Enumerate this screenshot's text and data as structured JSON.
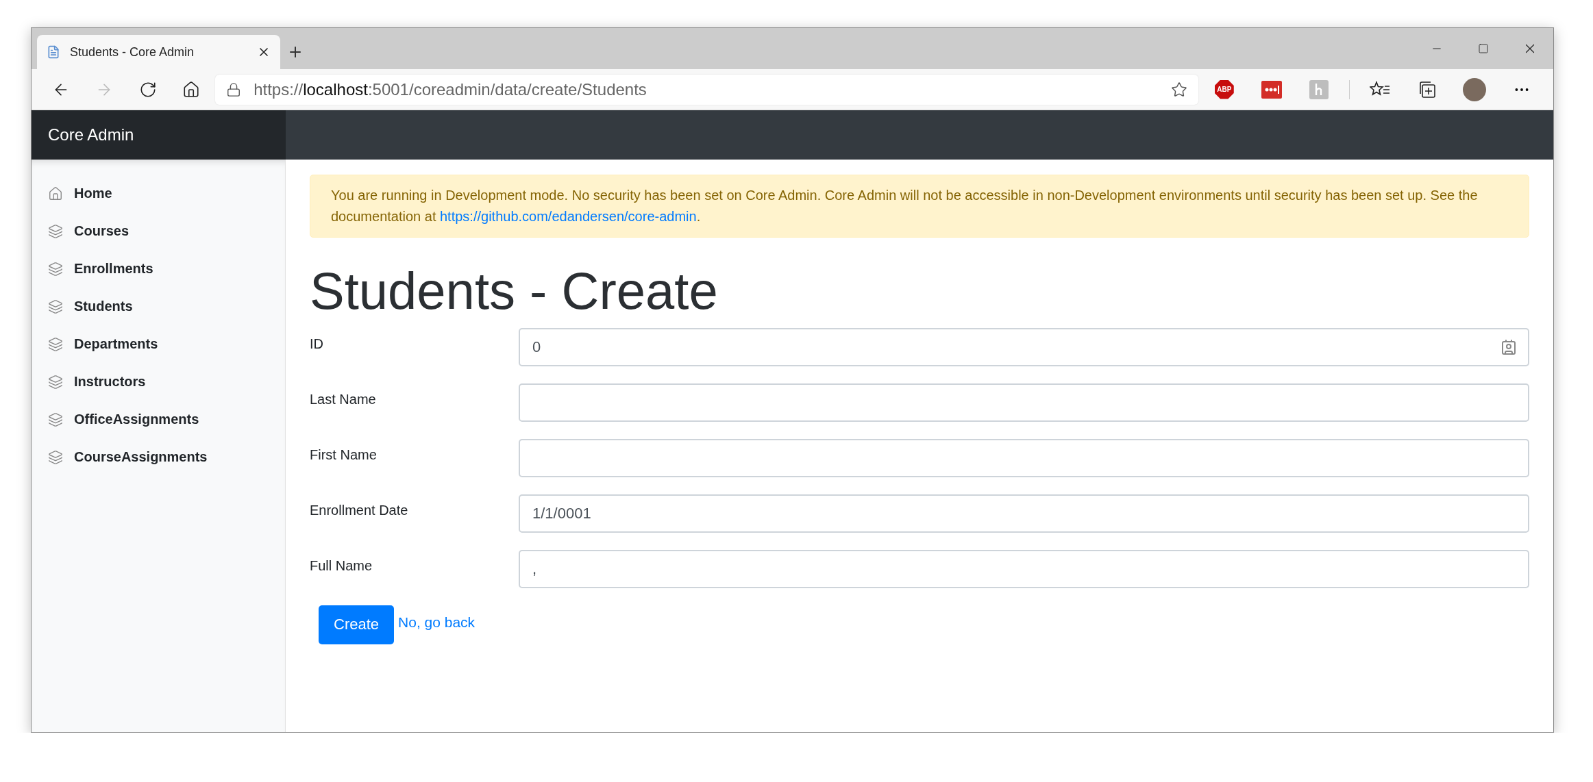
{
  "browser": {
    "tab": {
      "title": "Students - Core Admin",
      "selected": true
    },
    "address": {
      "scheme": "https://",
      "host": "localhost",
      "path": ":5001/coreadmin/data/create/Students"
    },
    "extensions": [
      {
        "kind": "abp",
        "label": "ABP"
      },
      {
        "kind": "lastpass"
      },
      {
        "kind": "honey"
      }
    ]
  },
  "navbar": {
    "brand": "Core Admin"
  },
  "sidebar": {
    "items": [
      {
        "label": "Home",
        "kind": "home"
      },
      {
        "label": "Courses",
        "kind": "entity"
      },
      {
        "label": "Enrollments",
        "kind": "entity"
      },
      {
        "label": "Students",
        "kind": "entity"
      },
      {
        "label": "Departments",
        "kind": "entity"
      },
      {
        "label": "Instructors",
        "kind": "entity"
      },
      {
        "label": "OfficeAssignments",
        "kind": "entity"
      },
      {
        "label": "CourseAssignments",
        "kind": "entity"
      }
    ]
  },
  "alert": {
    "text": "You are running in Development mode. No security has been set on Core Admin. Core Admin will not be accessible in non-Development environments until security has been set up. See the documentation at ",
    "link": "https://github.com/edandersen/core-admin",
    "after": "."
  },
  "page": {
    "title": "Students - Create"
  },
  "form": {
    "fields": [
      {
        "label": "ID",
        "value": "0",
        "kind": "id"
      },
      {
        "label": "Last Name",
        "kind": "text"
      },
      {
        "label": "First Name",
        "kind": "text"
      },
      {
        "label": "Enrollment Date",
        "value": "1/1/0001",
        "kind": "text"
      },
      {
        "label": "Full Name",
        "value": ",",
        "kind": "text"
      }
    ],
    "submit": "Create",
    "back": "No, go back"
  }
}
